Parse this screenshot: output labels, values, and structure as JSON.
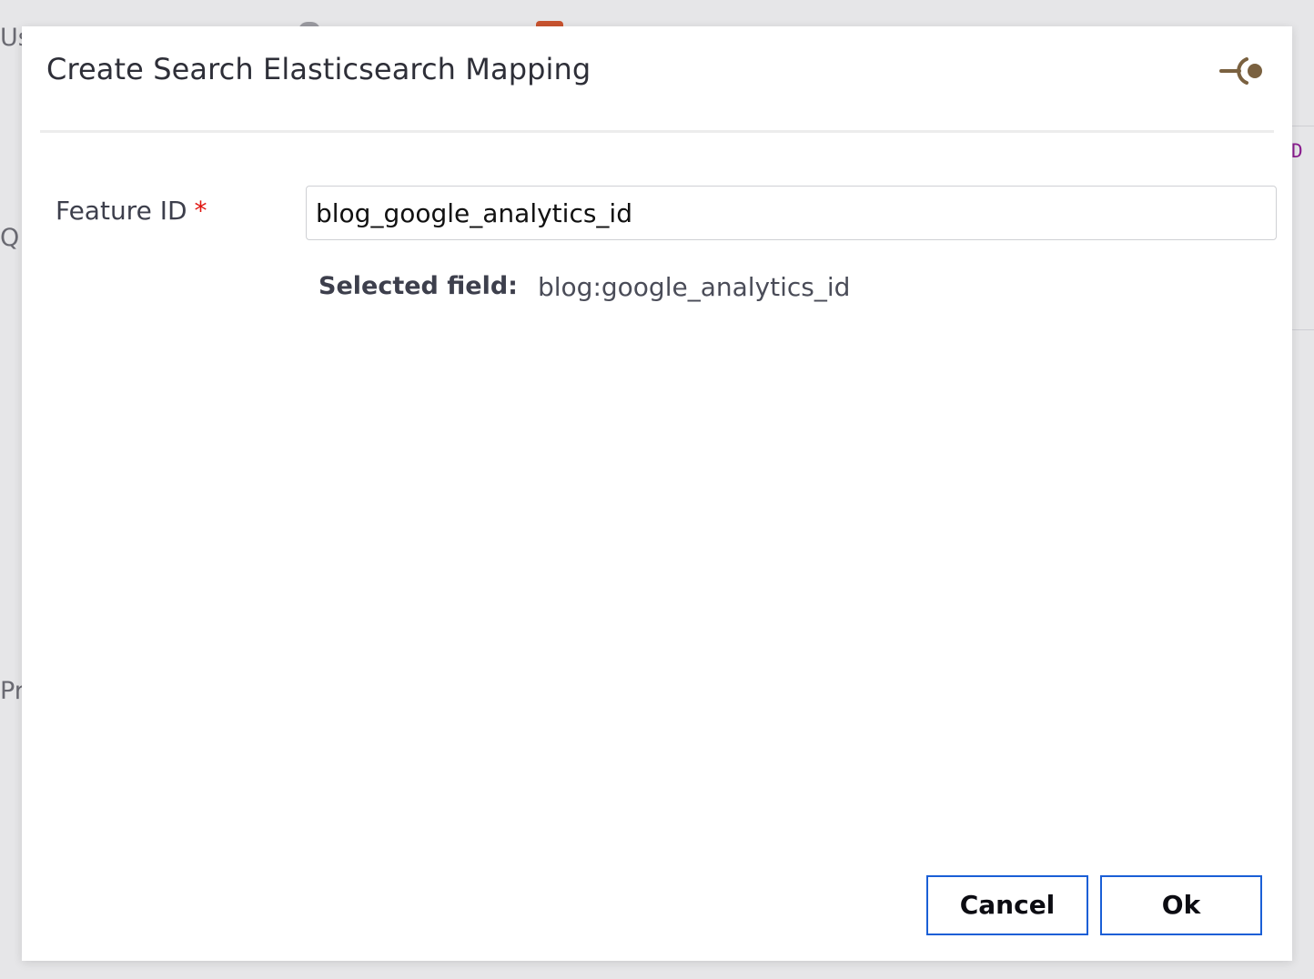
{
  "background": {
    "fragment_us": "Us",
    "fragment_q": "Q",
    "fragment_pr": "Pr",
    "fragment_d": "D"
  },
  "dialog": {
    "title": "Create Search Elasticsearch Mapping",
    "pin_icon": "pin-icon",
    "feature_id": {
      "label": "Feature ID",
      "required_marker": "*",
      "value": "blog_google_analytics_id"
    },
    "selected_field": {
      "label": "Selected field:",
      "value": "blog:google_analytics_id"
    },
    "buttons": {
      "cancel_label": "Cancel",
      "ok_label": "Ok"
    }
  },
  "colors": {
    "accent_border": "#1a5fd6",
    "required": "#e0140f",
    "pin_icon": "#7a6140",
    "title_text": "#2e2f38"
  }
}
